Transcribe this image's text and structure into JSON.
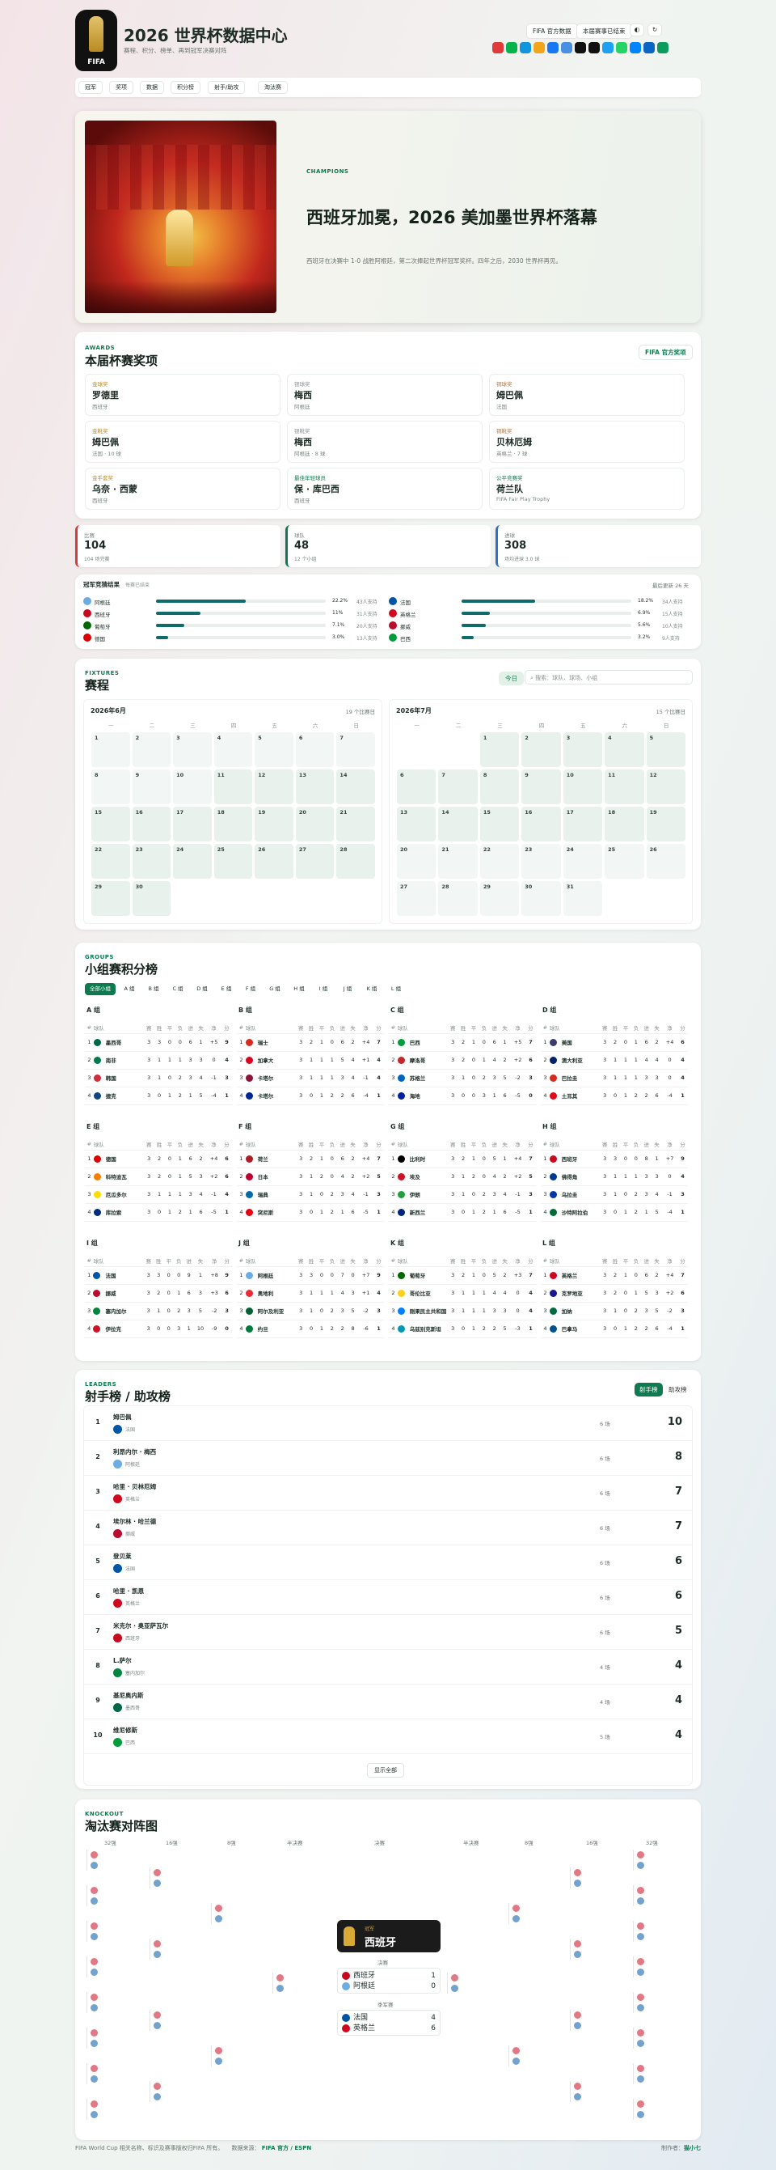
{
  "header": {
    "title": "2026 世界杯数据中心",
    "subtitle": "赛程、积分、榜单、再到冠军决赛对阵",
    "logo_text": "FIFA",
    "btn_official": "FIFA 官方数据",
    "btn_update": "本届赛事已结束"
  },
  "share_colors": [
    "#e03a3a",
    "#08b34a",
    "#1296db",
    "#f1a51a",
    "#1877f2",
    "#4a90e2",
    "#111111",
    "#111111",
    "#1da1f2",
    "#25d366",
    "#0084ff",
    "#0a66c2",
    "#0b9b5e"
  ],
  "nav": [
    "冠军",
    "奖项",
    "数据",
    "积分榜",
    "射手/助攻",
    "淘汰赛"
  ],
  "hero": {
    "eyebrow": "CHAMPIONS",
    "title": "西班牙加冕，2026 美加墨世界杯落幕",
    "desc": "西班牙在决赛中 1-0 战胜阿根廷，第二次捧起世界杯冠军奖杯。四年之后，2030 世界杯再见。"
  },
  "awards": {
    "eyebrow": "AWARDS",
    "title": "本届杯赛奖项",
    "link": "FIFA 官方奖项",
    "items": [
      {
        "cat": "金球奖",
        "name": "罗德里",
        "team": "西班牙",
        "color": "#c88a11"
      },
      {
        "cat": "银球奖",
        "name": "梅西",
        "team": "阿根廷",
        "color": "#8a9399"
      },
      {
        "cat": "铜球奖",
        "name": "姆巴佩",
        "team": "法国",
        "color": "#b9763b"
      },
      {
        "cat": "金靴奖",
        "name": "姆巴佩",
        "team": "法国 · 10 球",
        "color": "#c88a11"
      },
      {
        "cat": "银靴奖",
        "name": "梅西",
        "team": "阿根廷 · 8 球",
        "color": "#8a9399"
      },
      {
        "cat": "铜靴奖",
        "name": "贝林厄姆",
        "team": "英格兰 · 7 球",
        "color": "#b9763b"
      },
      {
        "cat": "金手套奖",
        "name": "乌奈 · 西蒙",
        "team": "西班牙",
        "color": "#c88a11"
      },
      {
        "cat": "最佳年轻球员",
        "name": "保 · 库巴西",
        "team": "西班牙",
        "color": "#0e7a4f"
      },
      {
        "cat": "公平竞赛奖",
        "name": "荷兰队",
        "team": "FIFA Fair Play Trophy",
        "color": "#0e7a4f"
      }
    ]
  },
  "stats": [
    {
      "label": "比赛",
      "value": "104",
      "sub": "104 场完赛",
      "color": "#d93b3b"
    },
    {
      "label": "球队",
      "value": "48",
      "sub": "12 个小组",
      "color": "#0e7a4f"
    },
    {
      "label": "进球",
      "value": "308",
      "sub": "场均进球 3.0 球",
      "color": "#2f6fc9"
    }
  ],
  "odds": {
    "title": "冠军竞猜结果",
    "note": "每赛已结束",
    "right": "最后更新 26 天",
    "left": [
      {
        "team": "阿根廷",
        "flag": "#6cace4",
        "pct": "22.2%",
        "fill": 0.22,
        "sub": "43人支持"
      },
      {
        "team": "西班牙",
        "flag": "#c60b1e",
        "pct": "11%",
        "fill": 0.11,
        "sub": "31人支持"
      },
      {
        "team": "葡萄牙",
        "flag": "#006600",
        "pct": "7.1%",
        "fill": 0.07,
        "sub": "20人支持"
      },
      {
        "team": "德国",
        "flag": "#dd0000",
        "pct": "3.0%",
        "fill": 0.03,
        "sub": "13人支持"
      }
    ],
    "right_list": [
      {
        "team": "法国",
        "flag": "#0055a4",
        "pct": "18.2%",
        "fill": 0.18,
        "sub": "34人支持"
      },
      {
        "team": "英格兰",
        "flag": "#cf081f",
        "pct": "6.9%",
        "fill": 0.07,
        "sub": "15人支持"
      },
      {
        "team": "挪威",
        "flag": "#ba0c2f",
        "pct": "5.6%",
        "fill": 0.06,
        "sub": "10人支持"
      },
      {
        "team": "巴西",
        "flag": "#009c3b",
        "pct": "3.2%",
        "fill": 0.03,
        "sub": "9人支持"
      }
    ]
  },
  "fixtures": {
    "eyebrow": "FIXTURES",
    "title": "赛程",
    "today": "今日",
    "search_placeholder": "搜索：球队、球场、小组",
    "june": {
      "title": "2026年6月",
      "count": "19 个比赛日"
    },
    "july": {
      "title": "2026年7月",
      "count": "15 个比赛日"
    },
    "weekdays": [
      "一",
      "二",
      "三",
      "四",
      "五",
      "六",
      "日"
    ]
  },
  "groups": {
    "eyebrow": "GROUPS",
    "title": "小组赛积分榜",
    "tabs": [
      "全部小组",
      "A 组",
      "B 组",
      "C 组",
      "D 组",
      "E 组",
      "F 组",
      "G 组",
      "H 组",
      "I 组",
      "J 组",
      "K 组",
      "L 组"
    ],
    "cols": [
      "#",
      "球队",
      "赛",
      "胜",
      "平",
      "负",
      "进",
      "失",
      "净",
      "分"
    ],
    "list": [
      {
        "name": "A 组",
        "rows": [
          [
            "1",
            "墨西哥",
            "3",
            "3",
            "0",
            "0",
            "6",
            "1",
            "+5",
            "9"
          ],
          [
            "2",
            "南非",
            "3",
            "1",
            "1",
            "1",
            "3",
            "3",
            "0",
            "4"
          ],
          [
            "3",
            "韩国",
            "3",
            "1",
            "0",
            "2",
            "3",
            "4",
            "-1",
            "3"
          ],
          [
            "4",
            "捷克",
            "3",
            "0",
            "1",
            "2",
            "1",
            "5",
            "-4",
            "1"
          ]
        ],
        "flags": [
          "#006847",
          "#007a4d",
          "#cd2e3a",
          "#11457e"
        ]
      },
      {
        "name": "B 组",
        "rows": [
          [
            "1",
            "瑞士",
            "3",
            "2",
            "1",
            "0",
            "6",
            "2",
            "+4",
            "7"
          ],
          [
            "2",
            "加拿大",
            "3",
            "1",
            "1",
            "1",
            "5",
            "4",
            "+1",
            "4"
          ],
          [
            "3",
            "卡塔尔",
            "3",
            "1",
            "1",
            "1",
            "3",
            "4",
            "-1",
            "4"
          ],
          [
            "4",
            "卡塔尔",
            "3",
            "0",
            "1",
            "2",
            "2",
            "6",
            "-4",
            "1"
          ]
        ],
        "flags": [
          "#d52b1e",
          "#d80621",
          "#8a1538",
          "#002395"
        ]
      },
      {
        "name": "C 组",
        "rows": [
          [
            "1",
            "巴西",
            "3",
            "2",
            "1",
            "0",
            "6",
            "1",
            "+5",
            "7"
          ],
          [
            "2",
            "摩洛哥",
            "3",
            "2",
            "0",
            "1",
            "4",
            "2",
            "+2",
            "6"
          ],
          [
            "3",
            "苏格兰",
            "3",
            "1",
            "0",
            "2",
            "3",
            "5",
            "-2",
            "3"
          ],
          [
            "4",
            "海地",
            "3",
            "0",
            "0",
            "3",
            "1",
            "6",
            "-5",
            "0"
          ]
        ],
        "flags": [
          "#009c3b",
          "#c1272d",
          "#0065bf",
          "#00209f"
        ]
      },
      {
        "name": "D 组",
        "rows": [
          [
            "1",
            "美国",
            "3",
            "2",
            "0",
            "1",
            "6",
            "2",
            "+4",
            "6"
          ],
          [
            "2",
            "澳大利亚",
            "3",
            "1",
            "1",
            "1",
            "4",
            "4",
            "0",
            "4"
          ],
          [
            "3",
            "巴拉圭",
            "3",
            "1",
            "1",
            "1",
            "3",
            "3",
            "0",
            "4"
          ],
          [
            "4",
            "土耳其",
            "3",
            "0",
            "1",
            "2",
            "2",
            "6",
            "-4",
            "1"
          ]
        ],
        "flags": [
          "#3c3b6e",
          "#012169",
          "#d52b1e",
          "#e30a17"
        ]
      },
      {
        "name": "E 组",
        "rows": [
          [
            "1",
            "德国",
            "3",
            "2",
            "0",
            "1",
            "6",
            "2",
            "+4",
            "6"
          ],
          [
            "2",
            "科特迪瓦",
            "3",
            "2",
            "0",
            "1",
            "5",
            "3",
            "+2",
            "6"
          ],
          [
            "3",
            "厄瓜多尔",
            "3",
            "1",
            "1",
            "1",
            "3",
            "4",
            "-1",
            "4"
          ],
          [
            "4",
            "库拉索",
            "3",
            "0",
            "1",
            "2",
            "1",
            "6",
            "-5",
            "1"
          ]
        ],
        "flags": [
          "#dd0000",
          "#f77f00",
          "#ffdd00",
          "#002b7f"
        ]
      },
      {
        "name": "F 组",
        "rows": [
          [
            "1",
            "荷兰",
            "3",
            "2",
            "1",
            "0",
            "6",
            "2",
            "+4",
            "7"
          ],
          [
            "2",
            "日本",
            "3",
            "1",
            "2",
            "0",
            "4",
            "2",
            "+2",
            "5"
          ],
          [
            "3",
            "瑞典",
            "3",
            "1",
            "0",
            "2",
            "3",
            "4",
            "-1",
            "3"
          ],
          [
            "4",
            "突尼斯",
            "3",
            "0",
            "1",
            "2",
            "1",
            "6",
            "-5",
            "1"
          ]
        ],
        "flags": [
          "#ae1c28",
          "#bc002d",
          "#006aa7",
          "#e70013"
        ]
      },
      {
        "name": "G 组",
        "rows": [
          [
            "1",
            "比利时",
            "3",
            "2",
            "1",
            "0",
            "5",
            "1",
            "+4",
            "7"
          ],
          [
            "2",
            "埃及",
            "3",
            "1",
            "2",
            "0",
            "4",
            "2",
            "+2",
            "5"
          ],
          [
            "3",
            "伊朗",
            "3",
            "1",
            "0",
            "2",
            "3",
            "4",
            "-1",
            "3"
          ],
          [
            "4",
            "新西兰",
            "3",
            "0",
            "1",
            "2",
            "1",
            "6",
            "-5",
            "1"
          ]
        ],
        "flags": [
          "#000000",
          "#ce1126",
          "#239f40",
          "#00247d"
        ]
      },
      {
        "name": "H 组",
        "rows": [
          [
            "1",
            "西班牙",
            "3",
            "3",
            "0",
            "0",
            "8",
            "1",
            "+7",
            "9"
          ],
          [
            "2",
            "佛得角",
            "3",
            "1",
            "1",
            "1",
            "3",
            "3",
            "0",
            "4"
          ],
          [
            "3",
            "乌拉圭",
            "3",
            "1",
            "0",
            "2",
            "3",
            "4",
            "-1",
            "3"
          ],
          [
            "4",
            "沙特阿拉伯",
            "3",
            "0",
            "1",
            "2",
            "1",
            "5",
            "-4",
            "1"
          ]
        ],
        "flags": [
          "#c60b1e",
          "#003893",
          "#0038a8",
          "#006c35"
        ]
      },
      {
        "name": "I 组",
        "rows": [
          [
            "1",
            "法国",
            "3",
            "3",
            "0",
            "0",
            "9",
            "1",
            "+8",
            "9"
          ],
          [
            "2",
            "挪威",
            "3",
            "2",
            "0",
            "1",
            "6",
            "3",
            "+3",
            "6"
          ],
          [
            "3",
            "塞内加尔",
            "3",
            "1",
            "0",
            "2",
            "3",
            "5",
            "-2",
            "3"
          ],
          [
            "4",
            "伊拉克",
            "3",
            "0",
            "0",
            "3",
            "1",
            "10",
            "-9",
            "0"
          ]
        ],
        "flags": [
          "#0055a4",
          "#ba0c2f",
          "#00853f",
          "#ce1126"
        ]
      },
      {
        "name": "J 组",
        "rows": [
          [
            "1",
            "阿根廷",
            "3",
            "3",
            "0",
            "0",
            "7",
            "0",
            "+7",
            "9"
          ],
          [
            "2",
            "奥地利",
            "3",
            "1",
            "1",
            "1",
            "4",
            "3",
            "+1",
            "4"
          ],
          [
            "3",
            "阿尔及利亚",
            "3",
            "1",
            "0",
            "2",
            "3",
            "5",
            "-2",
            "3"
          ],
          [
            "4",
            "约旦",
            "3",
            "0",
            "1",
            "2",
            "2",
            "8",
            "-6",
            "1"
          ]
        ],
        "flags": [
          "#6cace4",
          "#ed2939",
          "#006233",
          "#007a3d"
        ]
      },
      {
        "name": "K 组",
        "rows": [
          [
            "1",
            "葡萄牙",
            "3",
            "2",
            "1",
            "0",
            "5",
            "2",
            "+3",
            "7"
          ],
          [
            "2",
            "哥伦比亚",
            "3",
            "1",
            "1",
            "1",
            "4",
            "4",
            "0",
            "4"
          ],
          [
            "3",
            "刚果民主共和国",
            "3",
            "1",
            "1",
            "1",
            "3",
            "3",
            "0",
            "4"
          ],
          [
            "4",
            "乌兹别克斯坦",
            "3",
            "0",
            "1",
            "2",
            "2",
            "5",
            "-3",
            "1"
          ]
        ],
        "flags": [
          "#006600",
          "#fcd116",
          "#007fff",
          "#0099b5"
        ]
      },
      {
        "name": "L 组",
        "rows": [
          [
            "1",
            "英格兰",
            "3",
            "2",
            "1",
            "0",
            "6",
            "2",
            "+4",
            "7"
          ],
          [
            "2",
            "克罗地亚",
            "3",
            "2",
            "0",
            "1",
            "5",
            "3",
            "+2",
            "6"
          ],
          [
            "3",
            "加纳",
            "3",
            "1",
            "0",
            "2",
            "3",
            "5",
            "-2",
            "3"
          ],
          [
            "4",
            "巴拿马",
            "3",
            "0",
            "1",
            "2",
            "2",
            "6",
            "-4",
            "1"
          ]
        ],
        "flags": [
          "#cf081f",
          "#171796",
          "#006b3f",
          "#005293"
        ]
      }
    ]
  },
  "leaders": {
    "eyebrow": "LEADERS",
    "title": "射手榜 / 助攻榜",
    "tab_scorers": "射手榜",
    "tab_assists": "助攻榜",
    "show_all": "显示全部",
    "list": [
      {
        "rank": "1",
        "name": "姆巴佩",
        "team": "法国",
        "sub": "6 场",
        "goals": "10",
        "flag": "#0055a4"
      },
      {
        "rank": "2",
        "name": "利昂内尔 · 梅西",
        "team": "阿根廷",
        "sub": "6 场",
        "goals": "8",
        "flag": "#6cace4"
      },
      {
        "rank": "3",
        "name": "哈里 · 贝林厄姆",
        "team": "英格兰",
        "sub": "6 场",
        "goals": "7",
        "flag": "#cf081f"
      },
      {
        "rank": "4",
        "name": "埃尔林 · 哈兰德",
        "team": "挪威",
        "sub": "6 场",
        "goals": "7",
        "flag": "#ba0c2f"
      },
      {
        "rank": "5",
        "name": "登贝莱",
        "team": "法国",
        "sub": "6 场",
        "goals": "6",
        "flag": "#0055a4"
      },
      {
        "rank": "6",
        "name": "哈里 · 凯恩",
        "team": "英格兰",
        "sub": "6 场",
        "goals": "6",
        "flag": "#cf081f"
      },
      {
        "rank": "7",
        "name": "米克尔 · 奥亚萨瓦尔",
        "team": "西班牙",
        "sub": "6 场",
        "goals": "5",
        "flag": "#c60b1e"
      },
      {
        "rank": "8",
        "name": "L.萨尔",
        "team": "塞内加尔",
        "sub": "4 场",
        "goals": "4",
        "flag": "#00853f"
      },
      {
        "rank": "9",
        "name": "基尼奥内斯",
        "team": "墨西哥",
        "sub": "4 场",
        "goals": "4",
        "flag": "#006847"
      },
      {
        "rank": "10",
        "name": "维尼修斯",
        "team": "巴西",
        "sub": "5 场",
        "goals": "4",
        "flag": "#009c3b"
      }
    ]
  },
  "knockout": {
    "eyebrow": "KNOCKOUT",
    "title": "淘汰赛对阵图",
    "rounds": [
      "32强",
      "16强",
      "8强",
      "半决赛",
      "决赛",
      "半决赛",
      "8强",
      "16强",
      "32强"
    ],
    "champion_label": "冠军",
    "champion": "西班牙",
    "final_label": "决赛",
    "third_label": "季军赛",
    "final": [
      {
        "team": "西班牙",
        "flag": "#c60b1e",
        "score": "1"
      },
      {
        "team": "阿根廷",
        "flag": "#6cace4",
        "score": "0"
      }
    ],
    "third": [
      {
        "team": "法国",
        "flag": "#0055a4",
        "score": "4"
      },
      {
        "team": "英格兰",
        "flag": "#cf081f",
        "score": "6"
      }
    ]
  },
  "footer": {
    "left": "FIFA World Cup 相关名称、标识及赛事版权归FIFA 所有。",
    "source_label": "数据来源：",
    "source": "FIFA 官方 / ESPN",
    "right_label": "制作者：",
    "right": "猫小七"
  }
}
